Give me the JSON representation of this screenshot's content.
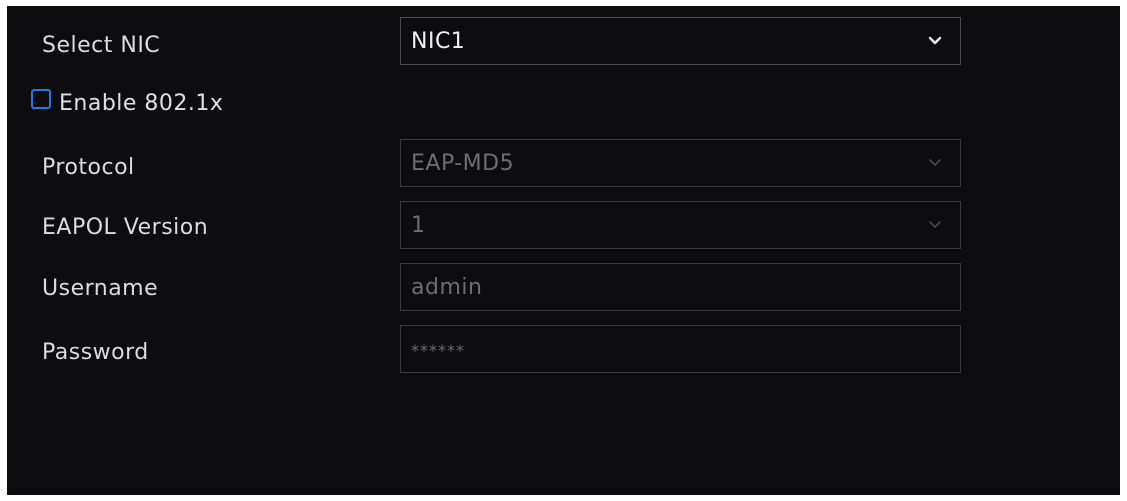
{
  "form": {
    "select_nic": {
      "label": "Select NIC",
      "value": "NIC1"
    },
    "enable_8021x": {
      "label": "Enable 802.1x",
      "checked": false
    },
    "protocol": {
      "label": "Protocol",
      "value": "EAP-MD5"
    },
    "eapol_version": {
      "label": "EAPOL Version",
      "value": "1"
    },
    "username": {
      "label": "Username",
      "value": "admin"
    },
    "password": {
      "label": "Password",
      "value": "******"
    }
  },
  "colors": {
    "background": "#0d0d0f",
    "checkbox_accent": "#1e7be0",
    "field_border": "#3a3a3d",
    "disabled_text": "#6e6e72"
  },
  "icons": {
    "dropdown": "chevron-down-icon"
  }
}
